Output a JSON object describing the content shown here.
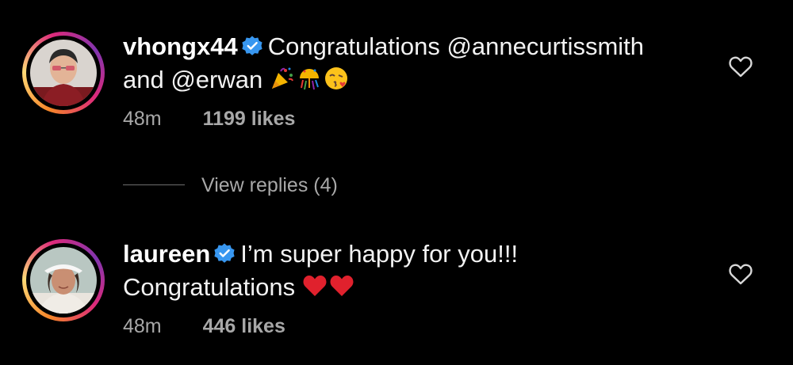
{
  "comments": [
    {
      "username": "vhongx44",
      "verified": true,
      "text_line1": "Congratulations @annecurtissmith",
      "text_line2": "and @erwan",
      "emojis": [
        "party-popper",
        "confetti-ball",
        "face-blowing-kiss"
      ],
      "time": "48m",
      "likes": "1199 likes"
    },
    {
      "username": "laureen",
      "verified": true,
      "text_line1": "I’m super happy for you!!!",
      "text_line2": "Congratulations",
      "emojis": [
        "red-heart",
        "red-heart"
      ],
      "time": "48m",
      "likes": "446 likes"
    }
  ],
  "view_replies": "View replies (4)",
  "colors": {
    "background": "#000000",
    "text": "#f2f2f2",
    "meta": "#a8a8a8",
    "verified": "#3897f0",
    "heart": "#e0212d"
  }
}
